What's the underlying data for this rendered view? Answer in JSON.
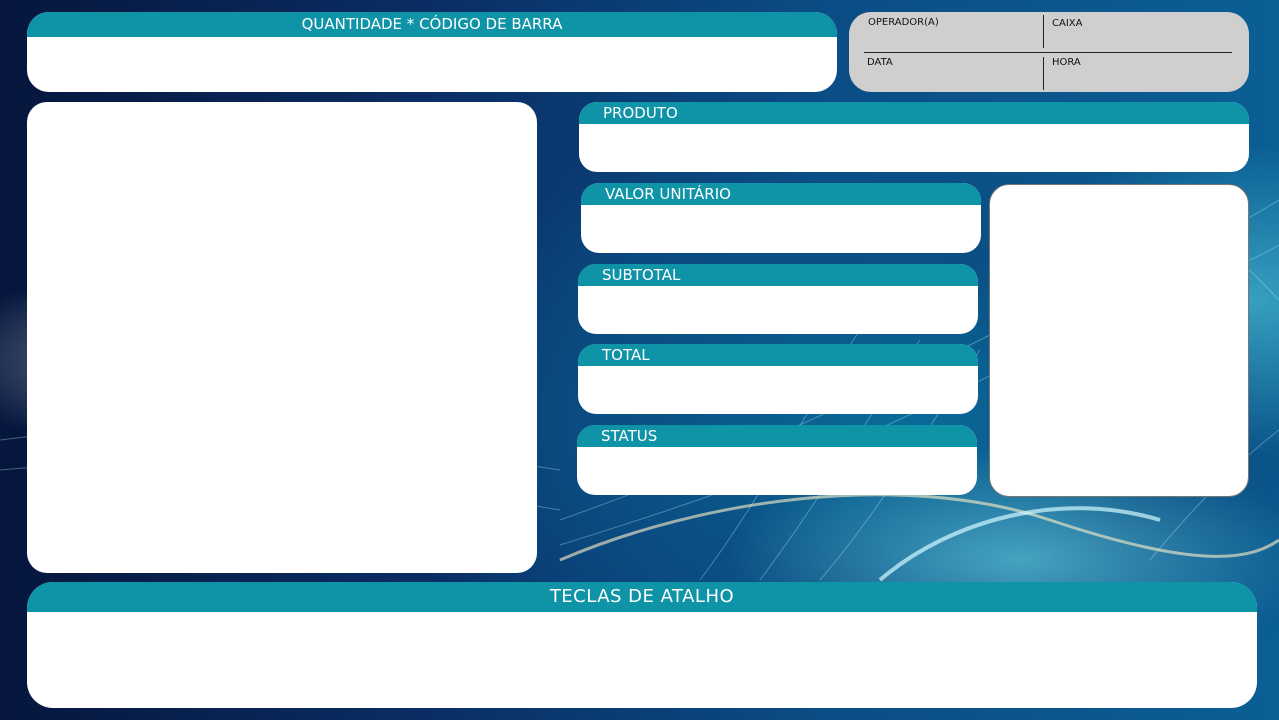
{
  "quantity_panel": {
    "title": "QUANTIDADE * CÓDIGO DE BARRA"
  },
  "info_panel": {
    "operator_label": "OPERADOR(A)",
    "register_label": "CAIXA",
    "date_label": "DATA",
    "time_label": "HORA"
  },
  "fields": {
    "product_label": "PRODUTO",
    "unit_value_label": "VALOR UNITÁRIO",
    "subtotal_label": "SUBTOTAL",
    "total_label": "TOTAL",
    "status_label": "STATUS"
  },
  "shortcuts_panel": {
    "title": "TECLAS DE ATALHO"
  },
  "colors": {
    "header_teal": "#0f93a7",
    "panel_white": "#ffffff",
    "info_gray": "#cfcfcf",
    "background_navy": "#0a2f66"
  }
}
